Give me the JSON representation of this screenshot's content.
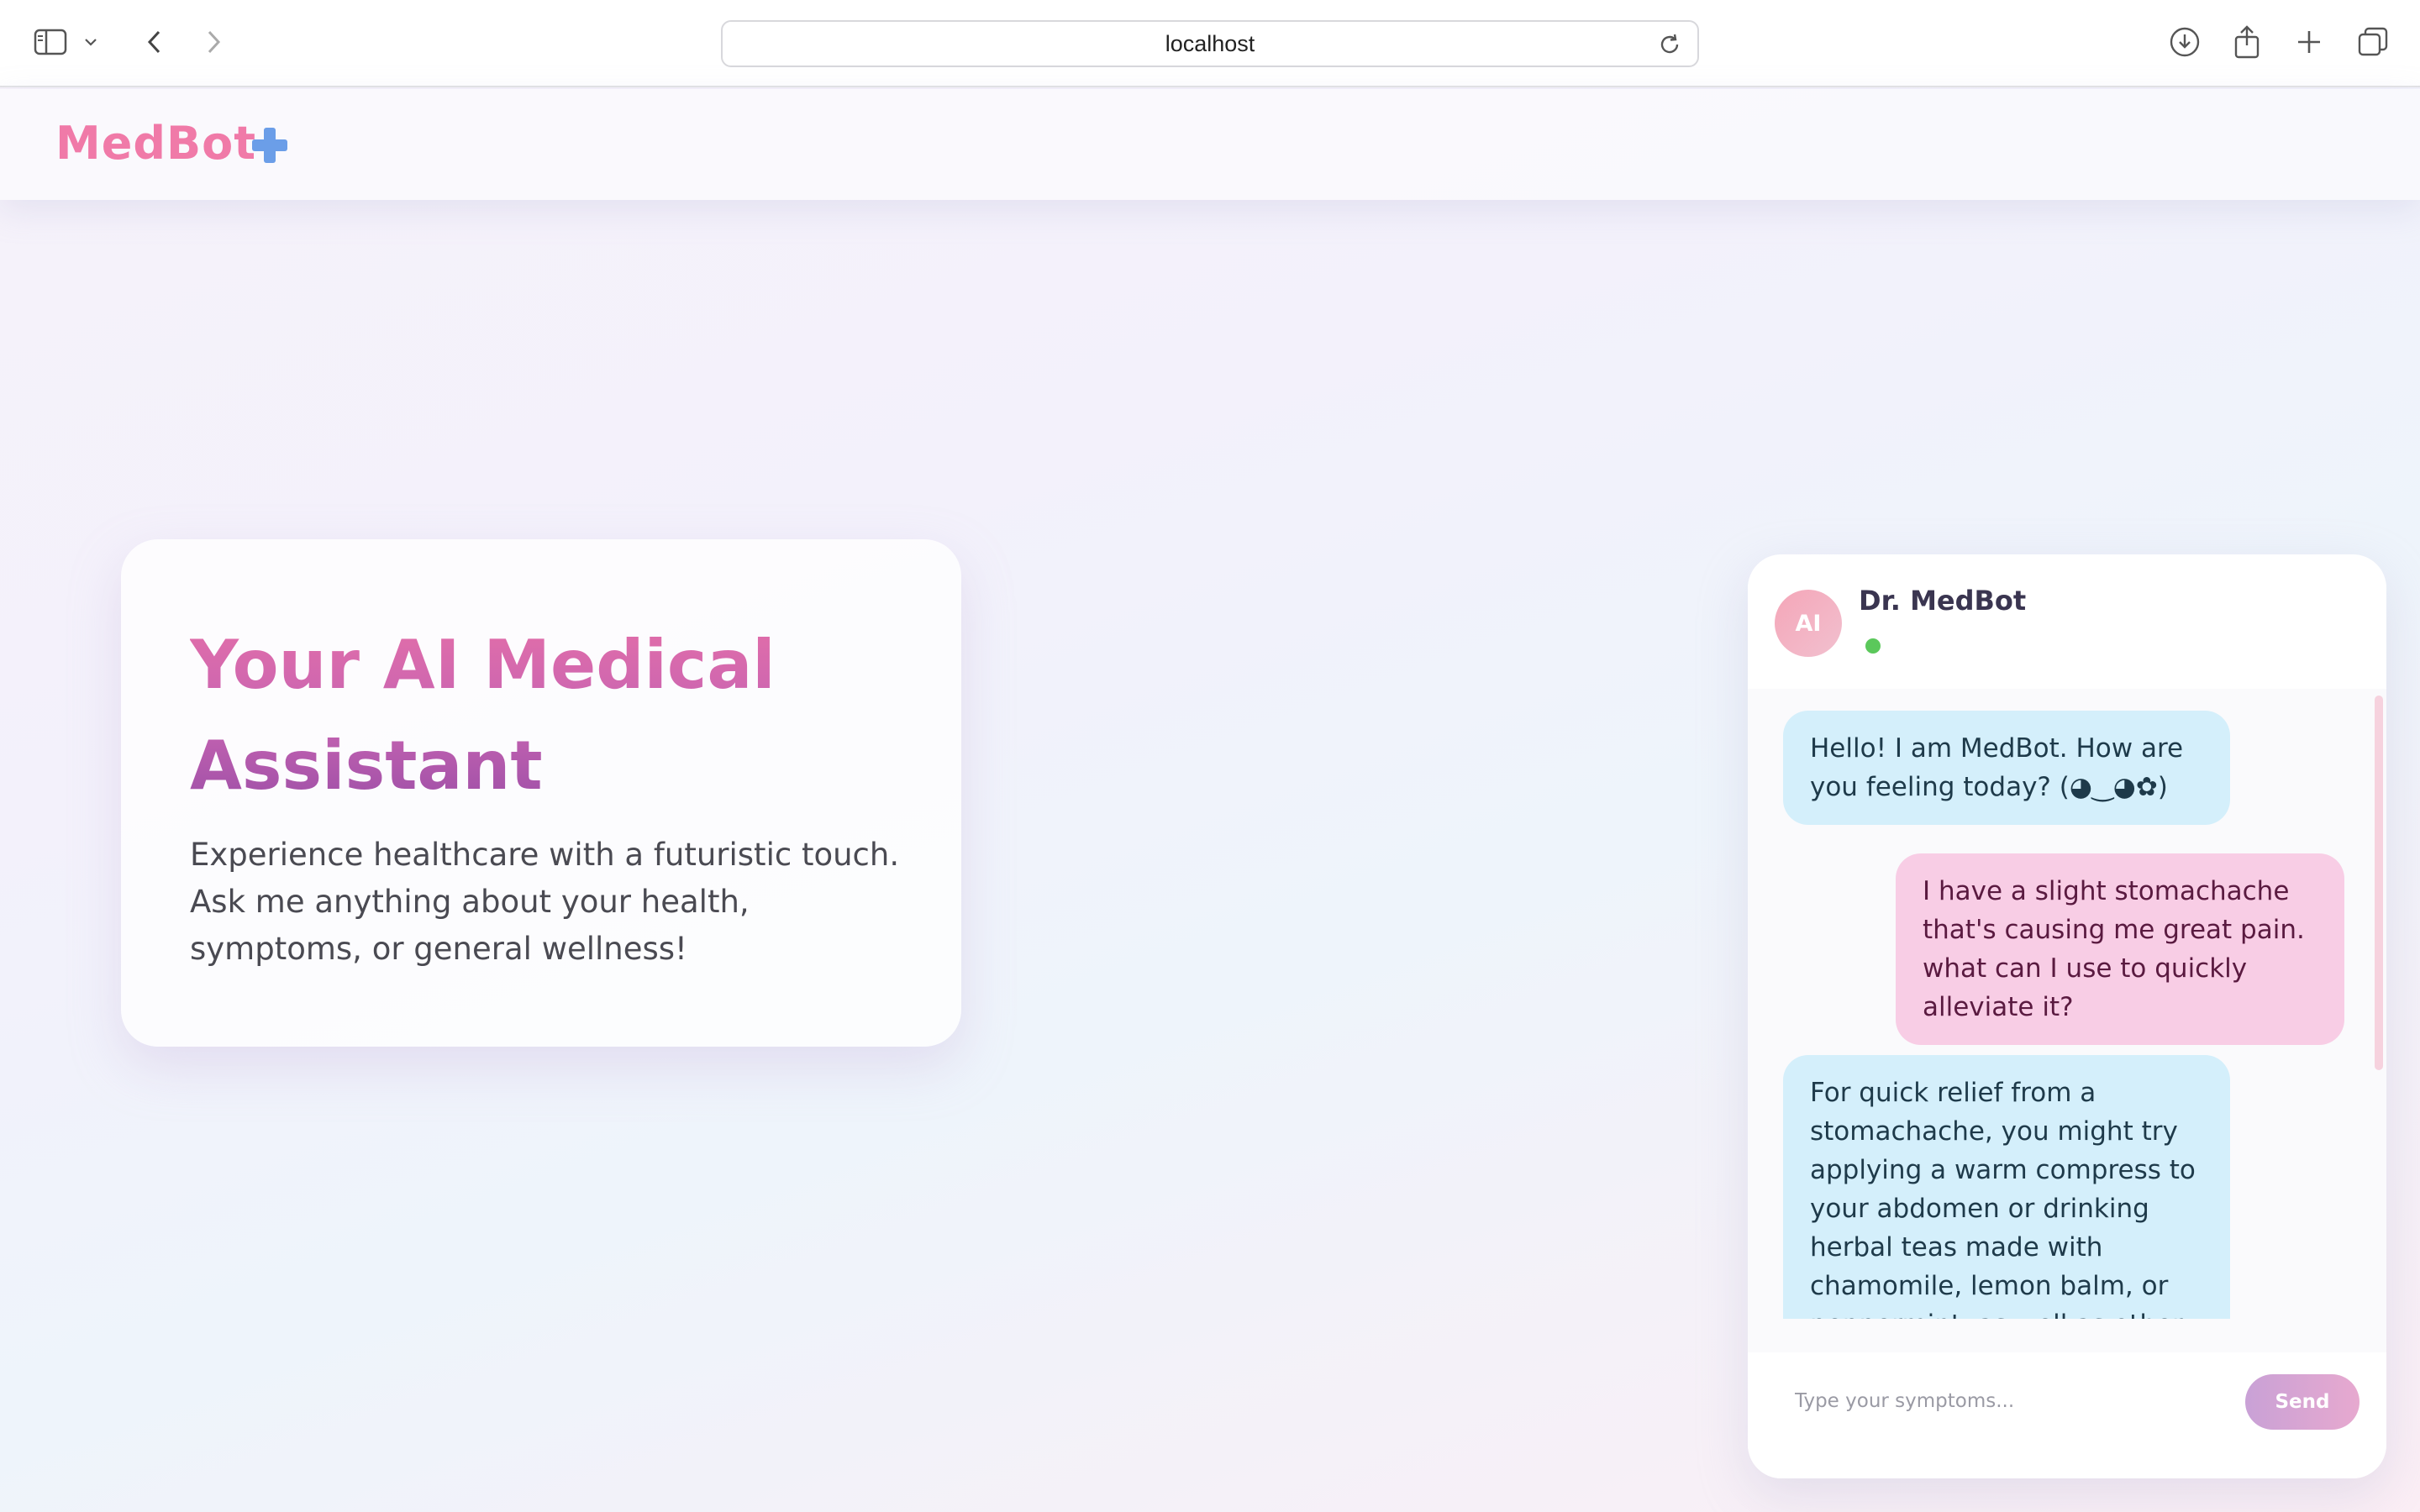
{
  "browser": {
    "url": "localhost"
  },
  "app": {
    "brand": "MedBot"
  },
  "hero": {
    "title": "Your AI Medical Assistant",
    "description": "Experience healthcare with a futuristic touch. Ask me anything about your health, symptoms, or general wellness!"
  },
  "chat": {
    "avatar_label": "AI",
    "agent_name": "Dr. MedBot",
    "status_color": "#5bc85b",
    "messages": [
      {
        "role": "bot",
        "text": "Hello! I am MedBot. How are you feeling today? (◕‿◕✿)"
      },
      {
        "role": "user",
        "text": "I have a slight stomachache that's causing me great pain. what can I use to quickly alleviate it?"
      },
      {
        "role": "bot",
        "text": "For quick relief from a stomachache, you might try applying a warm compress to your abdomen or drinking herbal teas made with chamomile, lemon balm, or peppermint, as well as other"
      }
    ],
    "input_placeholder": "Type your symptoms...",
    "send_label": "Send"
  },
  "colors": {
    "brand_pink": "#f07aa8",
    "brand_blue": "#6b9ee8",
    "bot_bubble": "#d4effb",
    "user_bubble": "#f8cde5"
  },
  "icons": {
    "sidebar": "sidebar-icon",
    "chevron": "chevron-down-icon",
    "back": "chevron-left-icon",
    "forward": "chevron-right-icon",
    "reload": "reload-icon",
    "download": "download-icon",
    "share": "share-icon",
    "new_tab": "plus-icon",
    "tabs": "tabs-icon",
    "medical": "medical-cross-icon"
  }
}
